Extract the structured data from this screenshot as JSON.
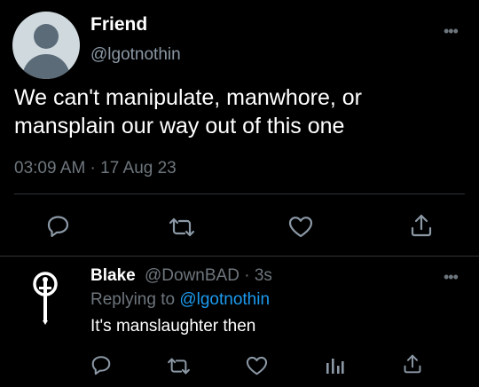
{
  "tweet": {
    "display_name": "Friend",
    "handle": "@lgotnothin",
    "text": "We can't manipulate, manwhore, or mansplain our way out of this one",
    "timestamp": "03:09 AM · 17 Aug 23"
  },
  "reply": {
    "display_name": "Blake",
    "handle_time": "@DownBAD · 3s",
    "replying_prefix": "Replying to ",
    "replying_handle": "@lgotnothin",
    "text": "It's manslaughter then"
  },
  "icons": {
    "more": "more-dots-icon",
    "reply": "reply-bubble-icon",
    "retweet": "retweet-icon",
    "like": "heart-icon",
    "share": "share-icon",
    "analytics": "analytics-icon"
  },
  "colors": {
    "background": "#000000",
    "text_primary": "#ffffff",
    "text_secondary": "#6e767d",
    "link": "#1d9bf0",
    "divider": "#2f3336"
  }
}
